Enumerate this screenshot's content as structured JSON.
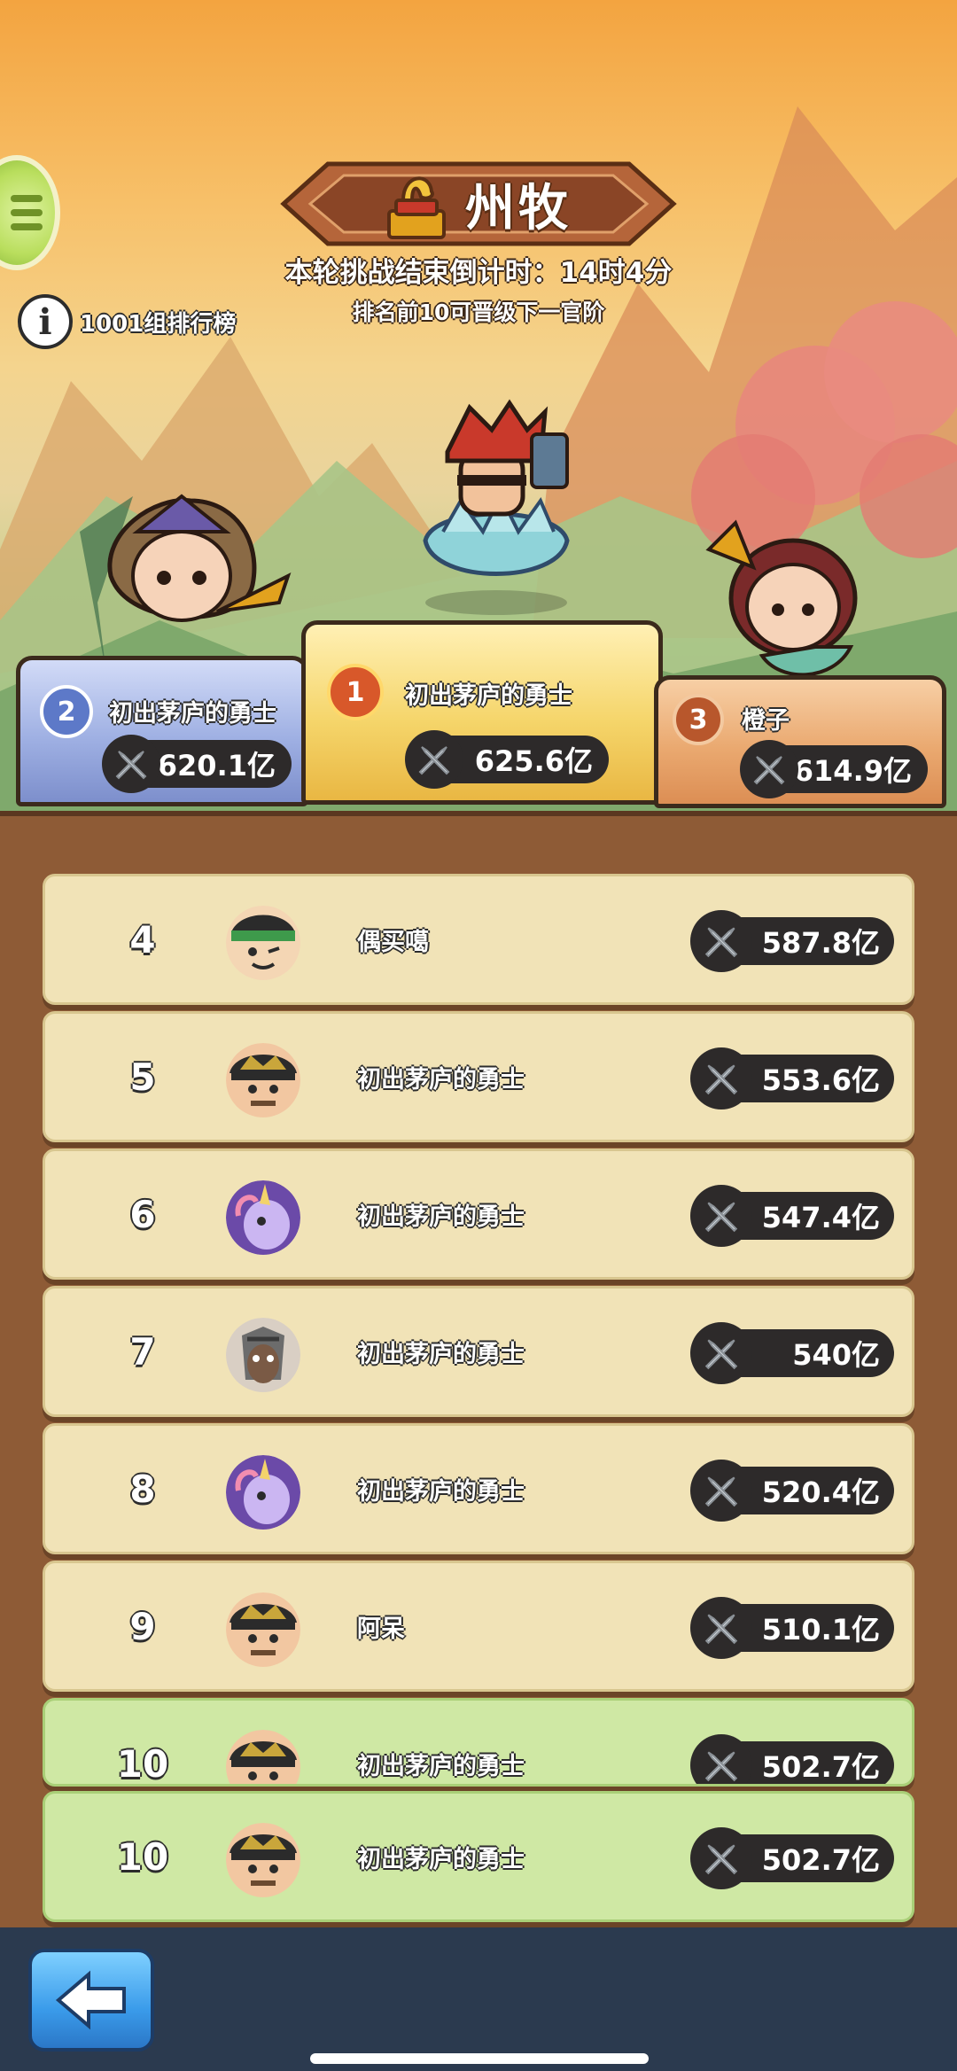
{
  "header": {
    "rank_title": "州牧",
    "countdown": "本轮挑战结束倒计时：14时4分",
    "promote_note": "排名前10可晋级下一官阶",
    "group_label": "1001组排行榜"
  },
  "podium": [
    {
      "rank": "2",
      "name": "初出茅庐的勇士",
      "power": "620.1亿"
    },
    {
      "rank": "1",
      "name": "初出茅庐的勇士",
      "power": "625.6亿"
    },
    {
      "rank": "3",
      "name": "橙子",
      "power": "614.9亿"
    }
  ],
  "rows": [
    {
      "rank": "4",
      "name": "偶买噶",
      "power": "587.8亿",
      "avatar": "green-headband-hero"
    },
    {
      "rank": "5",
      "name": "初出茅庐的勇士",
      "power": "553.6亿",
      "avatar": "crowned-hero"
    },
    {
      "rank": "6",
      "name": "初出茅庐的勇士",
      "power": "547.4亿",
      "avatar": "purple-unicorn"
    },
    {
      "rank": "7",
      "name": "初出茅庐的勇士",
      "power": "540亿",
      "avatar": "armored-horse"
    },
    {
      "rank": "8",
      "name": "初出茅庐的勇士",
      "power": "520.4亿",
      "avatar": "purple-unicorn"
    },
    {
      "rank": "9",
      "name": "阿呆",
      "power": "510.1亿",
      "avatar": "crowned-hero"
    },
    {
      "rank": "10",
      "name": "初出茅庐的勇士",
      "power": "502.7亿",
      "avatar": "crowned-hero"
    }
  ],
  "my_row": {
    "rank": "10",
    "name": "初出茅庐的勇士",
    "power": "502.7亿",
    "avatar": "crowned-hero"
  },
  "colors": {
    "row_bg": "#f1e3b7",
    "row_highlight": "#cfe8a4",
    "panel": "#8e5b36",
    "pill": "#2d2a2a"
  },
  "icons": [
    "menu-icon",
    "info-icon",
    "seal-icon",
    "sword-icon",
    "back-arrow-icon"
  ]
}
